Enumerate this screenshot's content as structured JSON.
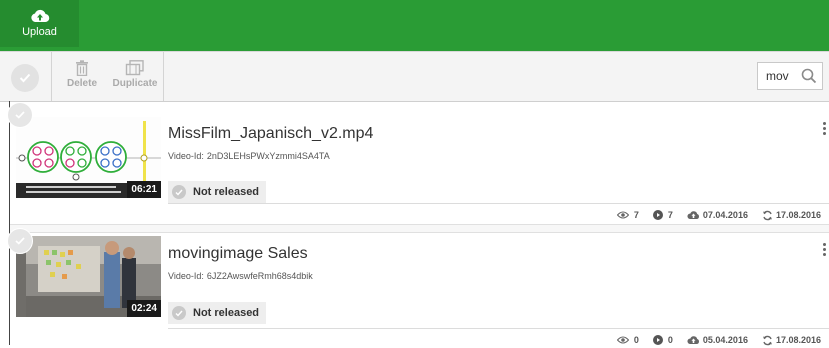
{
  "topbar": {
    "upload_label": "Upload"
  },
  "toolbar": {
    "delete_label": "Delete",
    "duplicate_label": "Duplicate",
    "search_value": "mov"
  },
  "videos": [
    {
      "title": "MissFilm_Japanisch_v2.mp4",
      "video_id_label": "Video-Id:",
      "video_id": "2nD3LEHsPWxYzmmi4SA4TA",
      "duration": "06:21",
      "status": "Not released",
      "views": "7",
      "plays": "7",
      "uploaded": "07.04.2016",
      "updated": "17.08.2016"
    },
    {
      "title": "movingimage Sales",
      "video_id_label": "Video-Id:",
      "video_id": "6JZ2AwswfeRmh68s4dbik",
      "duration": "02:24",
      "status": "Not released",
      "views": "0",
      "plays": "0",
      "uploaded": "05.04.2016",
      "updated": "17.08.2016"
    }
  ],
  "colors": {
    "brand_green": "#2a9c35",
    "toolbar_bg": "#f4f4f4"
  },
  "icons": [
    "cloud-upload-icon",
    "check-icon",
    "trash-icon",
    "duplicate-icon",
    "search-icon",
    "eye-icon",
    "play-icon",
    "cloud-upload-icon",
    "refresh-icon",
    "kebab-icon"
  ]
}
